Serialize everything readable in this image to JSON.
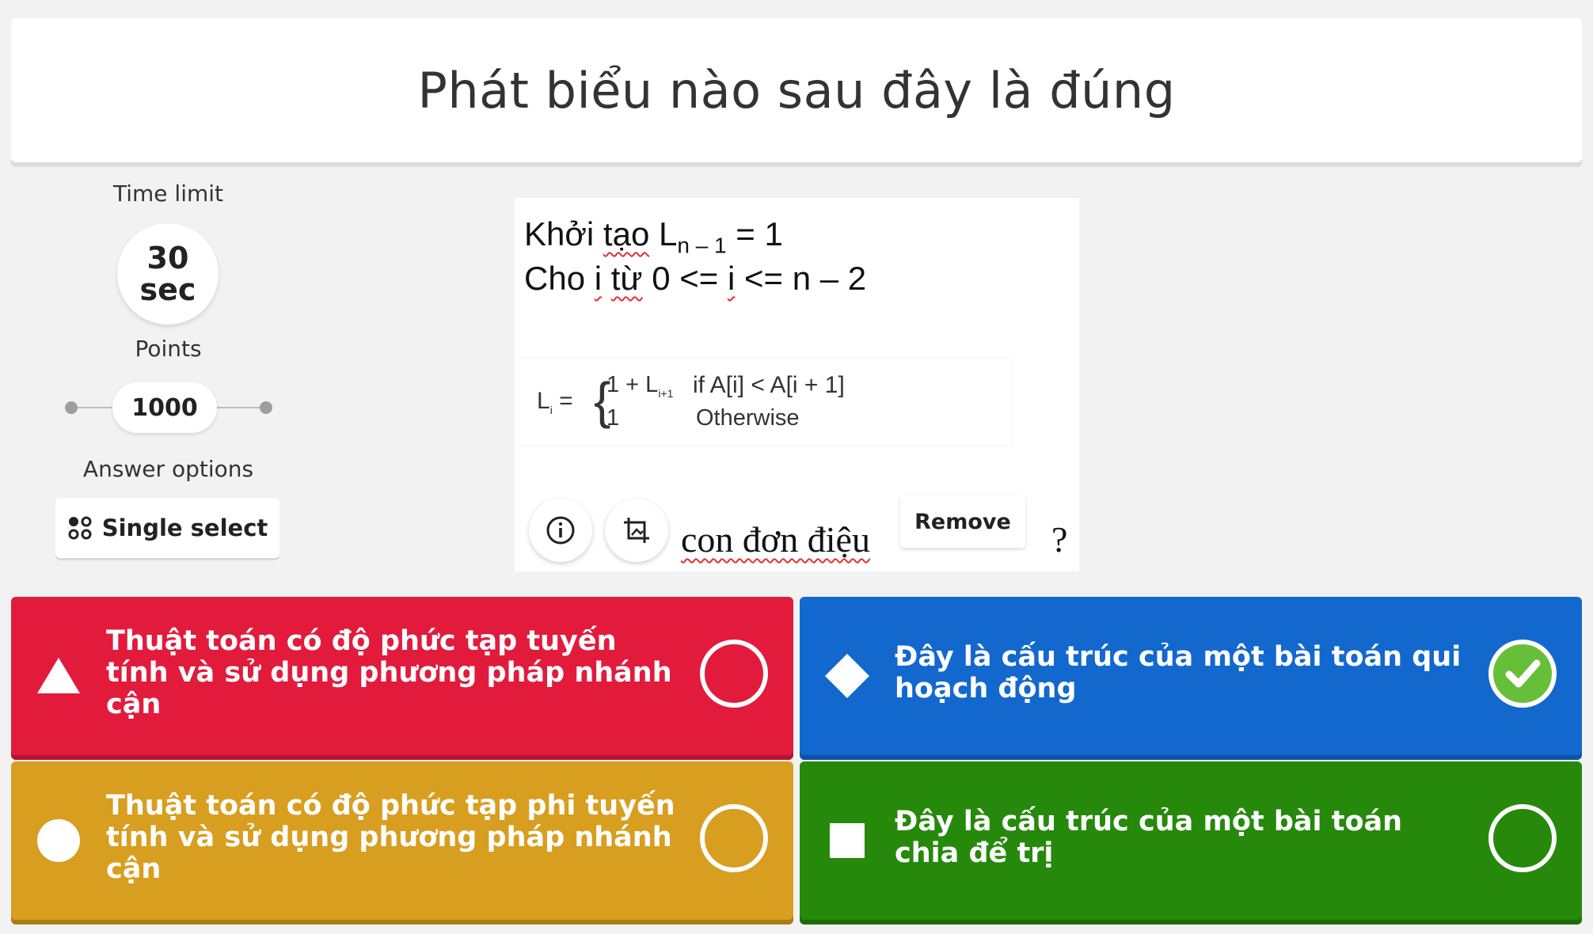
{
  "question": {
    "title": "Phát biểu nào sau đây là đúng"
  },
  "settings": {
    "time_limit_label": "Time limit",
    "time_value": "30",
    "time_unit": "sec",
    "points_label": "Points",
    "points_value": "1000",
    "answer_options_label": "Answer options",
    "answer_mode": "Single select"
  },
  "media": {
    "line1_prefix": "Khởi ",
    "line1_word": "tạo",
    "line1_var": " L",
    "line1_sub": "n – 1",
    "line1_suffix": " = 1",
    "line2_prefix": "Cho ",
    "line2_i": "i",
    "line2_tu": "từ",
    "line2_mid": " 0 <= ",
    "line2_i2": "i",
    "line2_suffix": " <= n – 2",
    "formula_lhs": "L",
    "formula_lhs_sub": "i",
    "formula_case1": "1 + L",
    "formula_case1_sub": "i+1",
    "formula_case1_cond": "if A[i] < A[i + 1]",
    "formula_case2": "1",
    "formula_case2_cond": "Otherwise",
    "tail_text": "con đơn điệu",
    "tail_end": "?",
    "remove_label": "Remove"
  },
  "answers": [
    {
      "text": "Thuật toán có độ phức tạp tuyến tính và sử dụng phương pháp nhánh cận",
      "shape": "triangle-icon",
      "color": "#e21b3c",
      "correct": false
    },
    {
      "text": "Đây là cấu trúc của một bài toán qui hoạch động",
      "shape": "diamond-icon",
      "color": "#1368ce",
      "correct": true
    },
    {
      "text": "Thuật toán có độ phức tạp phi tuyến tính và sử dụng phương pháp nhánh cận",
      "shape": "circle-icon",
      "color": "#d89e20",
      "correct": false
    },
    {
      "text": "Đây là cấu trúc của một bài toán chia để trị",
      "shape": "square-icon",
      "color": "#26890c",
      "correct": false
    }
  ]
}
